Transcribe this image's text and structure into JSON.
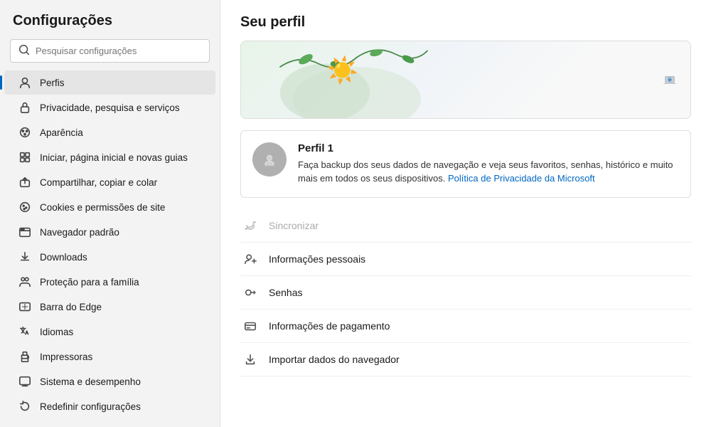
{
  "sidebar": {
    "title": "Configurações",
    "search": {
      "placeholder": "Pesquisar configurações"
    },
    "items": [
      {
        "id": "perfis",
        "label": "Perfis",
        "icon": "person-icon",
        "active": true
      },
      {
        "id": "privacidade",
        "label": "Privacidade, pesquisa e serviços",
        "icon": "lock-icon",
        "active": false
      },
      {
        "id": "aparencia",
        "label": "Aparência",
        "icon": "palette-icon",
        "active": false
      },
      {
        "id": "iniciar",
        "label": "Iniciar, página inicial e novas guias",
        "icon": "grid-icon",
        "active": false
      },
      {
        "id": "compartilhar",
        "label": "Compartilhar, copiar e colar",
        "icon": "share-icon",
        "active": false
      },
      {
        "id": "cookies",
        "label": "Cookies e permissões de site",
        "icon": "cookies-icon",
        "active": false
      },
      {
        "id": "navegador",
        "label": "Navegador padrão",
        "icon": "browser-icon",
        "active": false
      },
      {
        "id": "downloads",
        "label": "Downloads",
        "icon": "download-icon",
        "active": false
      },
      {
        "id": "protecao",
        "label": "Proteção para a família",
        "icon": "family-icon",
        "active": false
      },
      {
        "id": "barra",
        "label": "Barra do Edge",
        "icon": "edge-icon",
        "active": false
      },
      {
        "id": "idiomas",
        "label": "Idiomas",
        "icon": "language-icon",
        "active": false
      },
      {
        "id": "impressoras",
        "label": "Impressoras",
        "icon": "printer-icon",
        "active": false
      },
      {
        "id": "sistema",
        "label": "Sistema e desempenho",
        "icon": "system-icon",
        "active": false
      },
      {
        "id": "redefinir",
        "label": "Redefinir configurações",
        "icon": "reset-icon",
        "active": false
      }
    ]
  },
  "main": {
    "title": "Seu perfil",
    "profile": {
      "name": "Perfil 1",
      "description": "Faça backup dos seus dados de navegação e veja seus favoritos, senhas, histórico e muito mais em todos os seus dispositivos.",
      "link_text": "Política de Privacidade da Microsoft",
      "link_href": "#"
    },
    "menu_items": [
      {
        "id": "sincronizar",
        "label": "Sincronizar",
        "icon": "sync-icon",
        "disabled": true
      },
      {
        "id": "informacoes-pessoais",
        "label": "Informações pessoais",
        "icon": "person-detail-icon",
        "disabled": false
      },
      {
        "id": "senhas",
        "label": "Senhas",
        "icon": "key-icon",
        "disabled": false
      },
      {
        "id": "pagamento",
        "label": "Informações de pagamento",
        "icon": "card-icon",
        "disabled": false
      },
      {
        "id": "importar",
        "label": "Importar dados do navegador",
        "icon": "import-icon",
        "disabled": false
      }
    ]
  }
}
